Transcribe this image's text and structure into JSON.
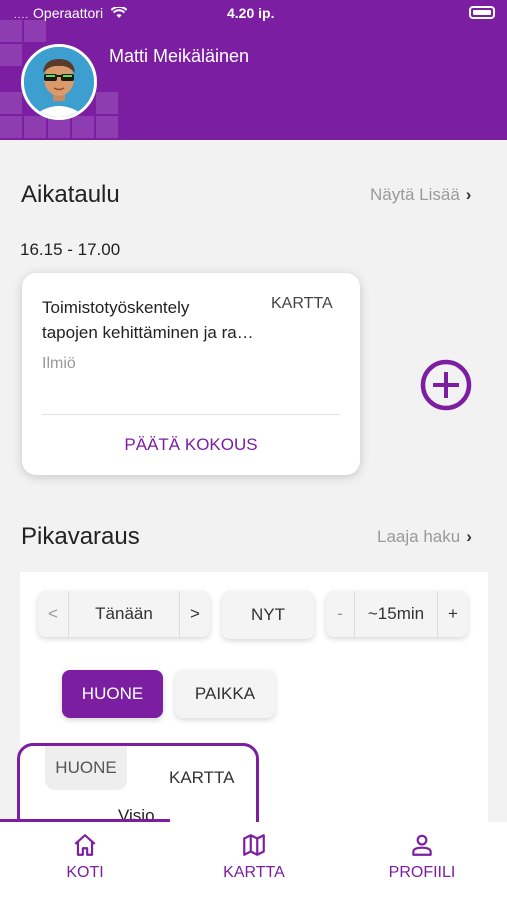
{
  "status_bar": {
    "carrier": "Operaattori",
    "time": "4.20 ip."
  },
  "user": {
    "name": "Matti  Meikäläinen"
  },
  "schedule": {
    "title": "Aikataulu",
    "more_label": "Näytä Lisää",
    "time_range": "16.15 - 17.00",
    "event": {
      "title_line1": "Toimistotyöskentely",
      "title_line2": "tapojen kehittäminen ja ra…",
      "map_label": "KARTTA",
      "location": "Ilmiö",
      "end_meeting_label": "PÄÄTÄ KOKOUS"
    }
  },
  "quick_booking": {
    "title": "Pikavaraus",
    "more_label": "Laaja haku",
    "date": {
      "prev": "<",
      "value": "Tänään",
      "next": ">"
    },
    "now_label": "NYT",
    "duration": {
      "minus": "-",
      "value": "~15min",
      "plus": "+"
    },
    "type_tabs": [
      {
        "label": "HUONE",
        "selected": true
      },
      {
        "label": "PAIKKA",
        "selected": false
      }
    ],
    "result_card": {
      "badge": "HUONE",
      "map_label": "KARTTA",
      "name": "Visio"
    }
  },
  "tabbar": [
    {
      "label": "KOTI",
      "icon": "home-icon"
    },
    {
      "label": "KARTTA",
      "icon": "map-icon"
    },
    {
      "label": "PROFIILI",
      "icon": "person-icon"
    }
  ],
  "colors": {
    "brand": "#7b1ea2"
  }
}
